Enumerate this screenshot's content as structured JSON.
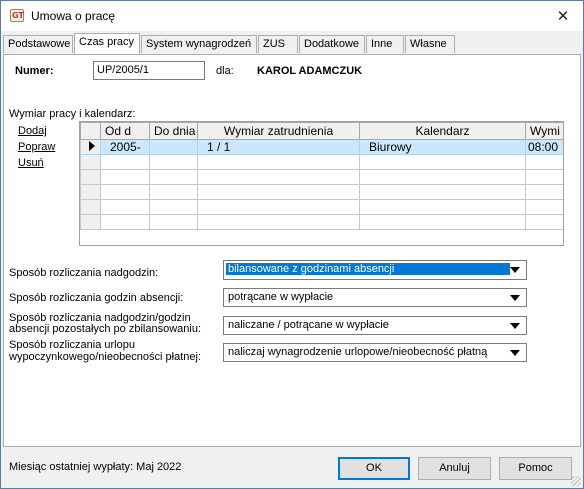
{
  "window": {
    "title": "Umowa o pracę",
    "app_icon_text": "GT",
    "close_glyph": "✕"
  },
  "tabs": [
    {
      "label": "Podstawowe",
      "active": false
    },
    {
      "label": "Czas pracy",
      "active": true
    },
    {
      "label": "System wynagrodzeń",
      "active": false
    },
    {
      "label": "ZUS",
      "active": false
    },
    {
      "label": "Dodatkowe",
      "active": false
    },
    {
      "label": "Inne",
      "active": false
    },
    {
      "label": "Własne",
      "active": false
    }
  ],
  "header": {
    "numer_label": "Numer:",
    "numer_value": "UP/2005/1",
    "dla_label": "dla:",
    "employee_name": "KAROL ADAMCZUK"
  },
  "schedule": {
    "section_label": "Wymiar pracy i kalendarz:",
    "actions": [
      "Dodaj",
      "Popraw",
      "Usuń"
    ],
    "columns": [
      "Od d",
      "Do dnia",
      "Wymiar zatrudnienia",
      "Kalendarz",
      "Wymi"
    ],
    "rows": [
      {
        "od": "2005-",
        "do": "",
        "wymiar": "1 / 1",
        "kalendarz": "Biurowy",
        "wymi": "08:00",
        "selected": true
      }
    ],
    "empty_rows": 5
  },
  "settings": {
    "nadgodziny": {
      "label": "Sposób rozliczania nadgodzin:",
      "value": "bilansowane z godzinami absencji"
    },
    "absencje": {
      "label": "Sposób rozliczania godzin absencji:",
      "value": "potrącane w wypłacie"
    },
    "pozostale": {
      "label_line1": "Sposób rozliczania nadgodzin/godzin",
      "label_line2": "absencji pozostałych po zbilansowaniu:",
      "value": "naliczane / potrącane w wypłacie"
    },
    "urlop": {
      "label_line1": "Sposób rozliczania urlopu",
      "label_line2": "wypoczynkowego/nieobecności płatnej:",
      "value": "naliczaj wynagrodzenie urlopowe/nieobecność płatną"
    }
  },
  "footer": {
    "status": "Miesiąc ostatniej wypłaty: Maj 2022",
    "ok_label": "OK",
    "cancel_label": "Anuluj",
    "help_label": "Pomoc"
  },
  "colors": {
    "selection_row": "#cce8ff",
    "highlight": "#0078d7"
  }
}
